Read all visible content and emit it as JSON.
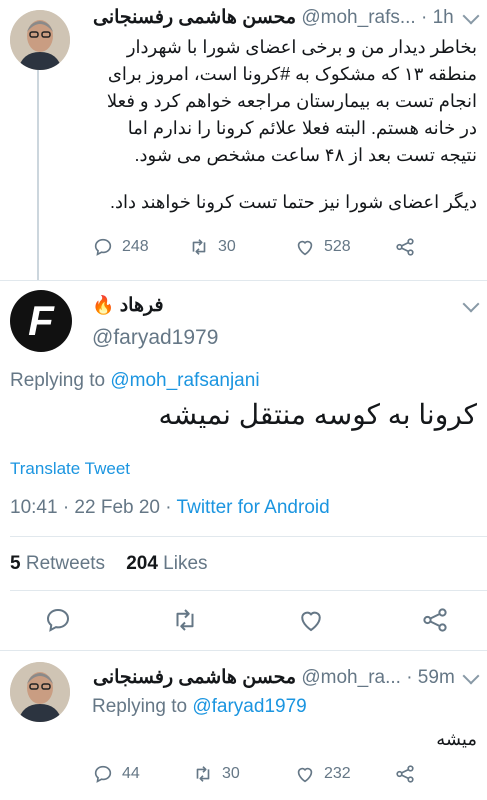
{
  "tweet1": {
    "name": "محسن هاشمی رفسنجانی",
    "handle": "@moh_rafs...",
    "time": "· 1h",
    "lines": [
      "بخاطر دیدار من و برخی اعضای شورا با شهردار",
      "منطقه ۱۳ که مشکوک به #کرونا است، امروز برای",
      "انجام تست به بیمارستان مراجعه خواهم کرد و فعلا",
      "در خانه هستم. البته فعلا علائم کرونا را ندارم اما",
      "نتیجه تست بعد از ۴۸ ساعت مشخص می شود.",
      "دیگر اعضای شورا نیز حتما تست کرونا خواهند داد."
    ],
    "replies": "248",
    "retweets": "30",
    "likes": "528"
  },
  "tweet2": {
    "name": "فرهاد",
    "handle": "@faryad1979",
    "avatar_letter": "F",
    "replying_label": "Replying to",
    "replying_to": "@moh_rafsanjani",
    "text": "کرونا به کوسه منتقل نمیشه",
    "translate": "Translate Tweet",
    "time": "10:41",
    "date": "· 22 Feb 20 ·",
    "client": "Twitter for Android",
    "retweets_count": "5",
    "retweets_label": "Retweets",
    "likes_count": "204",
    "likes_label": "Likes"
  },
  "tweet3": {
    "name": "محسن هاشمی رفسنجانی",
    "handle": "@moh_ra...",
    "time": "· 59m",
    "replying_label": "Replying to",
    "replying_to": "@faryad1979",
    "text": "میشه",
    "replies": "44",
    "retweets": "30",
    "likes": "232"
  },
  "icons": [
    "reply-icon",
    "retweet-icon",
    "like-icon",
    "share-icon",
    "chevron-down-icon",
    "fire-emoji"
  ],
  "colors": {
    "link": "#1b95e0",
    "muted": "#657786",
    "text": "#14171a",
    "divider": "#e1e8ed"
  }
}
